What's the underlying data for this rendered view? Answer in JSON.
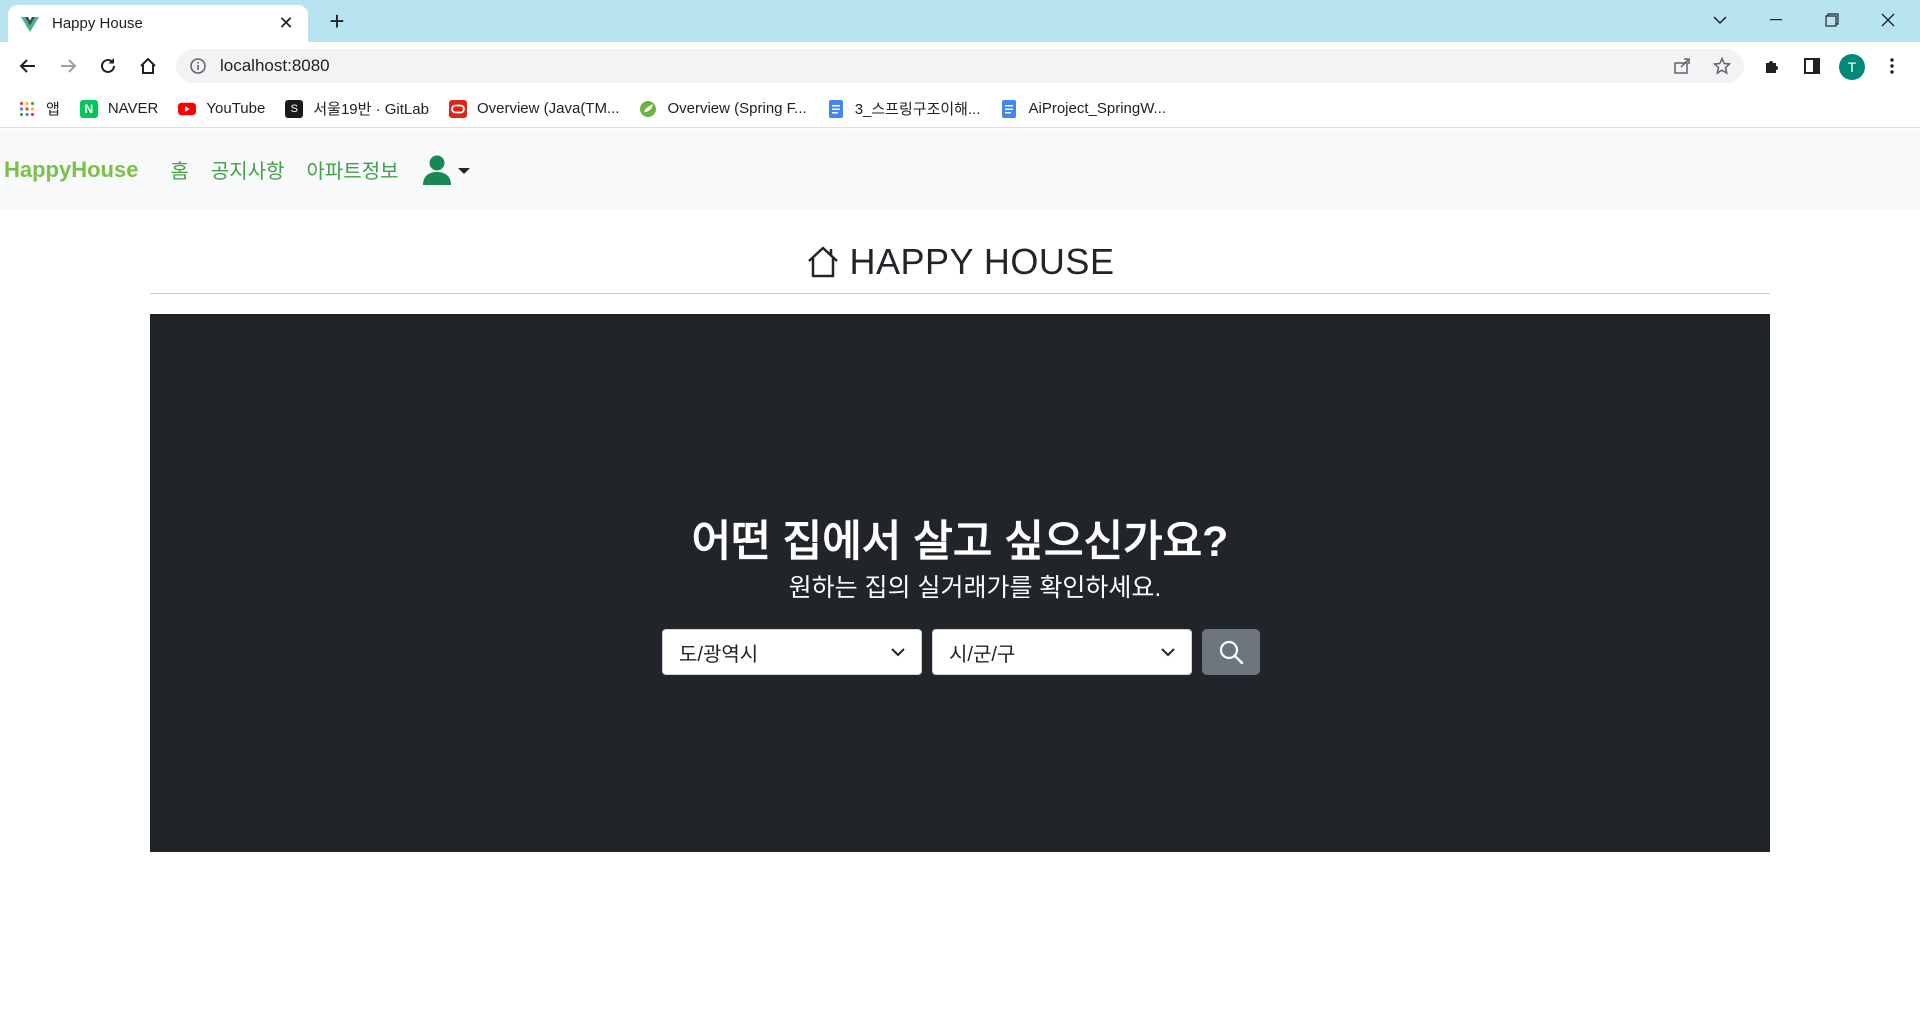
{
  "browser": {
    "tab_title": "Happy House",
    "url": "localhost:8080",
    "profile_initial": "T",
    "bookmarks": [
      {
        "label": "앱",
        "icon": "apps-grid-icon"
      },
      {
        "label": "NAVER",
        "icon": "naver-icon"
      },
      {
        "label": "YouTube",
        "icon": "youtube-icon"
      },
      {
        "label": "서울19반 · GitLab",
        "icon": "gitlab-icon"
      },
      {
        "label": "Overview (Java(TM...",
        "icon": "oracle-icon"
      },
      {
        "label": "Overview (Spring F...",
        "icon": "spring-icon"
      },
      {
        "label": "3_스프링구조이해...",
        "icon": "docs-icon"
      },
      {
        "label": "AiProject_SpringW...",
        "icon": "docs-icon"
      }
    ]
  },
  "navbar": {
    "brand": "HappyHouse",
    "links": [
      "홈",
      "공지사항",
      "아파트정보"
    ],
    "user_icon": "person-icon"
  },
  "heading": {
    "text": "HAPPY HOUSE",
    "icon": "house-icon"
  },
  "hero": {
    "title": "어떤 집에서 살고 싶으신가요?",
    "subtitle": "원하는 집의 실거래가를 확인하세요.",
    "select_sido": "도/광역시",
    "select_gugun": "시/군/구",
    "search_icon": "search-icon"
  },
  "colors": {
    "brand": "#7cc04a",
    "nav_link": "#43a047",
    "hero_bg": "#212529",
    "search_btn": "#6c757d",
    "tabstrip": "#b8e4f0"
  }
}
